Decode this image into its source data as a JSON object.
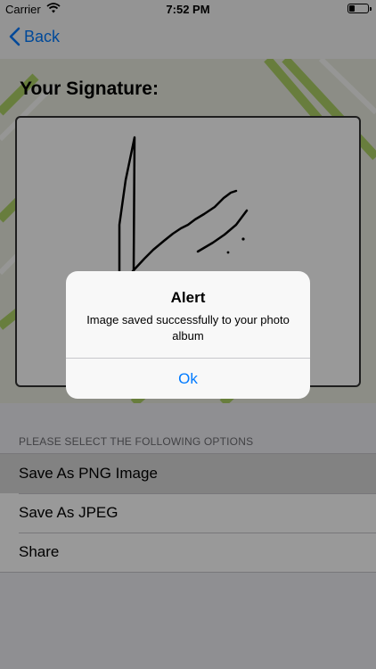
{
  "status_bar": {
    "carrier": "Carrier",
    "time": "7:52 PM"
  },
  "nav": {
    "back_label": "Back"
  },
  "signature": {
    "title": "Your Signature:"
  },
  "options": {
    "header": "PLEASE SELECT THE FOLLOWING OPTIONS",
    "items": [
      {
        "label": "Save As PNG Image",
        "selected": true
      },
      {
        "label": "Save As JPEG",
        "selected": false
      },
      {
        "label": "Share",
        "selected": false
      }
    ]
  },
  "alert": {
    "title": "Alert",
    "message": "Image saved successfully to your photo album",
    "button": "Ok"
  },
  "colors": {
    "accent": "#007aff",
    "decor_green": "#a7cf5a"
  }
}
